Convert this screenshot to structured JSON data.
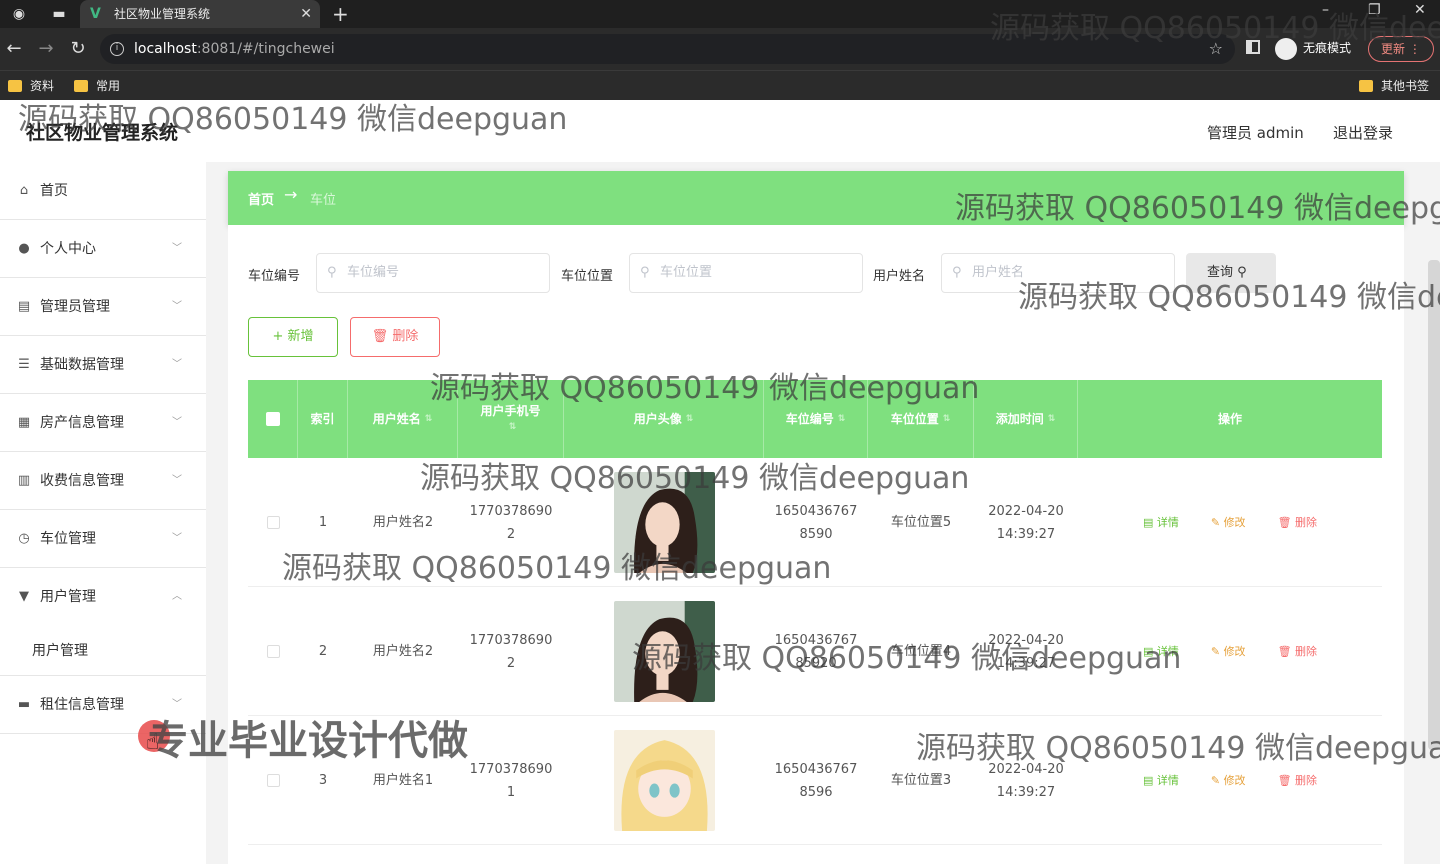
{
  "browser": {
    "tab_title": "社区物业管理系统",
    "url_host": "localhost",
    "url_rest": ":8081/#/tingchewei",
    "incognito_label": "无痕模式",
    "update_label": "更新",
    "bookmarks": [
      "资料",
      "常用"
    ],
    "other_bookmarks": "其他书签"
  },
  "app": {
    "title": "社区物业管理系统",
    "admin_label": "管理员 admin",
    "logout_label": "退出登录"
  },
  "sidebar": {
    "items": [
      {
        "label": "首页",
        "icon": "home-icon"
      },
      {
        "label": "个人中心",
        "icon": "user-icon"
      },
      {
        "label": "管理员管理",
        "icon": "id-card-icon"
      },
      {
        "label": "基础数据管理",
        "icon": "list-icon"
      },
      {
        "label": "房产信息管理",
        "icon": "grid-icon"
      },
      {
        "label": "收费信息管理",
        "icon": "document-icon"
      },
      {
        "label": "车位管理",
        "icon": "clock-icon"
      },
      {
        "label": "用户管理",
        "icon": "pin-icon"
      },
      {
        "label": "租住信息管理",
        "icon": "monitor-icon"
      }
    ],
    "submenu": {
      "label": "用户管理"
    }
  },
  "breadcrumb": {
    "home": "首页",
    "arrow": "→",
    "current": "车位"
  },
  "filters": {
    "f1": {
      "label": "车位编号",
      "placeholder": "车位编号"
    },
    "f2": {
      "label": "车位位置",
      "placeholder": "车位位置"
    },
    "f3": {
      "label": "用户姓名",
      "placeholder": "用户姓名"
    },
    "query_label": "查询"
  },
  "actions": {
    "add_label": "+ 新增",
    "delete_label": "删除"
  },
  "table": {
    "columns": {
      "index": "索引",
      "name": "用户姓名",
      "phone": "用户手机号",
      "avatar": "用户头像",
      "spot_no": "车位编号",
      "spot_loc": "车位位置",
      "added": "添加时间",
      "ops": "操作"
    },
    "rows": [
      {
        "index": "1",
        "name": "用户姓名2",
        "phone1": "1770378690",
        "phone2": "2",
        "no1": "1650436767",
        "no2": "8590",
        "loc": "车位位置5",
        "date": "2022-04-20",
        "time": "14:39:27"
      },
      {
        "index": "2",
        "name": "用户姓名2",
        "phone1": "1770378690",
        "phone2": "2",
        "no1": "1650436767",
        "no2": "85920",
        "loc": "车位位置4",
        "date": "2022-04-20",
        "time": "14:39:27"
      },
      {
        "index": "3",
        "name": "用户姓名1",
        "phone1": "1770378690",
        "phone2": "1",
        "no1": "1650436767",
        "no2": "8596",
        "loc": "车位位置3",
        "date": "2022-04-20",
        "time": "14:39:27"
      }
    ],
    "row_actions": {
      "detail": "详情",
      "edit": "修改",
      "delete": "删除"
    }
  },
  "watermarks": {
    "text": "源码获取 QQ86050149 微信deepguan",
    "secondary": "专业毕业设计代做"
  },
  "colors": {
    "accent_green": "#7fe07f",
    "success": "#67c23a",
    "danger": "#f56c6c",
    "warning": "#e6a23c"
  }
}
